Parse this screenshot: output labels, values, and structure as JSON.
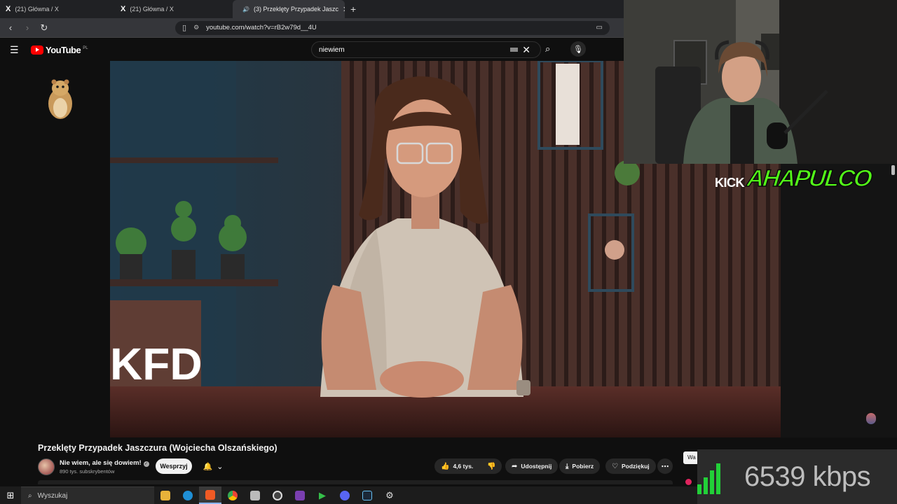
{
  "browser": {
    "tabs": [
      {
        "title": "(21) Główna / X",
        "active": false
      },
      {
        "title": "(21) Główna / X",
        "active": false
      },
      {
        "title": "(3) Przeklęty Przypadek Jaszc",
        "active": true
      }
    ],
    "new_tab_label": "+",
    "url": "youtube.com/watch?v=rB2w79d__4U"
  },
  "youtube": {
    "logo_text": "YouTube",
    "country_code": "PL",
    "search_query": "niewiem"
  },
  "video": {
    "watermark": "KFD",
    "title": "Przeklęty Przypadek Jaszczura (Wojciecha Olszańskiego)",
    "channel_name": "Nie wiem, ale się dowiem!",
    "subscribers": "890 tys. subskrybentów",
    "support_label": "Wesprzyj",
    "likes": "4,6 tys.",
    "share_label": "Udostępnij",
    "download_label": "Pobierz",
    "thanks_label": "Podziękuj",
    "side_tag": "Wa"
  },
  "stream_overlay": {
    "kick_text": "KICK",
    "channel_logo_text": "AHAPULCO",
    "bitrate": "6539 kbps",
    "accent_color": "#53fc18",
    "signal_color": "#22d038"
  },
  "taskbar": {
    "search_placeholder": "Wyszukaj",
    "icons": [
      "windows-start",
      "file-explorer",
      "edge",
      "brave",
      "chrome",
      "app-generic",
      "obs",
      "app-green",
      "media-player",
      "discord",
      "steam",
      "settings"
    ]
  }
}
